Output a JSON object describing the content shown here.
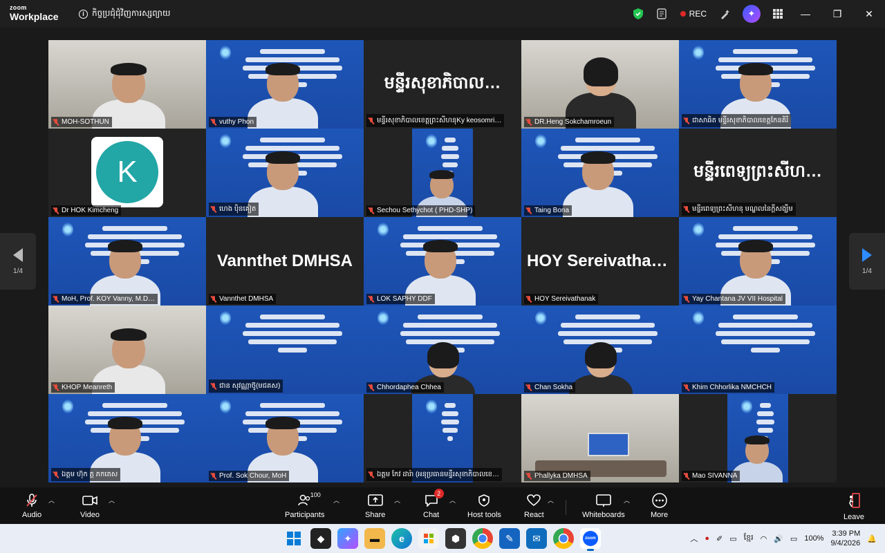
{
  "app": {
    "brand_line1": "zoom",
    "brand_line2": "Workplace",
    "meeting_title": "កិច្ចប្រជុំជុំវិញការស្សព្យាយ",
    "rec_label": "REC"
  },
  "participants": [
    {
      "name": "MOH-SOTHUN",
      "kind": "person"
    },
    {
      "name": "vuthy Phon",
      "kind": "slide-person"
    },
    {
      "name": "មន្ទីរសុខាភិបាលខេត្តព្រះសីហនុKy keosomri…",
      "kind": "text",
      "display_text": "មន្ទីរសុខាភិបាល…"
    },
    {
      "name": "DR.Heng Sokchamroeun",
      "kind": "person-woman"
    },
    {
      "name": "ជាសាឆិត មន្ទីរសុខាភិបាលខេត្តកែនគិរី",
      "kind": "slide-person"
    },
    {
      "name": "Dr HOK Kimcheng",
      "kind": "avatar",
      "avatar_letter": "K"
    },
    {
      "name": "ហេង ប៉ិនគៀត",
      "kind": "slide-person"
    },
    {
      "name": "Sechou Sethychot ( PHD-SHP)",
      "kind": "slide-person-small"
    },
    {
      "name": "Taing Bona",
      "kind": "slide-person"
    },
    {
      "name": "មន្ទីរពេទ្យព្រះសីហនុ មណ្ឌលនៃក្តីសង្ឃឹម",
      "kind": "text",
      "display_text": "មន្ទីរពេទ្យព្រះសីហ…"
    },
    {
      "name": "MoH, Prof. KOY Vanny, M.D…",
      "kind": "slide-person",
      "active": true
    },
    {
      "name": "Vannthet DMHSA",
      "kind": "text",
      "display_text": "Vannthet DMHSA"
    },
    {
      "name": "LOK SAPHY DDF",
      "kind": "slide-person"
    },
    {
      "name": "HOY Sereivathanak",
      "kind": "text",
      "display_text": "HOY  Sereivathan…"
    },
    {
      "name": "Yay Chantana JV VII Hospital",
      "kind": "slide-person"
    },
    {
      "name": "KHOP Meanreth",
      "kind": "person"
    },
    {
      "name": "ជាន សុវណ្ណាថ៊ូ(មជគស)",
      "kind": "slide"
    },
    {
      "name": "Chhordaphea Chhea",
      "kind": "slide-person-woman"
    },
    {
      "name": "Chan Sokha",
      "kind": "slide-person-woman"
    },
    {
      "name": "Khim Chhorlika NMCHCH",
      "kind": "slide"
    },
    {
      "name": "ឯ​ត្តម ហ៊ុក ភ្គ ភក​តេស",
      "kind": "slide-person"
    },
    {
      "name": "Prof. Sok Chour, MoH",
      "kind": "slide-person"
    },
    {
      "name": "ឯត្តម កែវ ដារ៉ា (អនុប្រធានមន្ទីរសុខាភិបាលខេ…",
      "kind": "slide-small"
    },
    {
      "name": "Phallyka DMHSA",
      "kind": "room"
    },
    {
      "name": "Mao SIVANNA",
      "kind": "slide-person-small"
    }
  ],
  "pager": {
    "left_label": "1/4",
    "right_label": "1/4"
  },
  "toolbar": {
    "audio": "Audio",
    "video": "Video",
    "participants": "Participants",
    "participant_count": "100",
    "share": "Share",
    "chat": "Chat",
    "chat_badge": "2",
    "host_tools": "Host tools",
    "react": "React",
    "whiteboards": "Whiteboards",
    "more": "More",
    "leave": "Leave"
  },
  "taskbar": {
    "language": "ខ្មែរ",
    "battery": "100%",
    "time": "3:39 PM",
    "date": "9/4/2026"
  },
  "colors": {
    "accent": "#2d8cff",
    "active_speaker": "#23d18b",
    "slide_blue": "#1e56b8",
    "rec": "#e02828"
  }
}
